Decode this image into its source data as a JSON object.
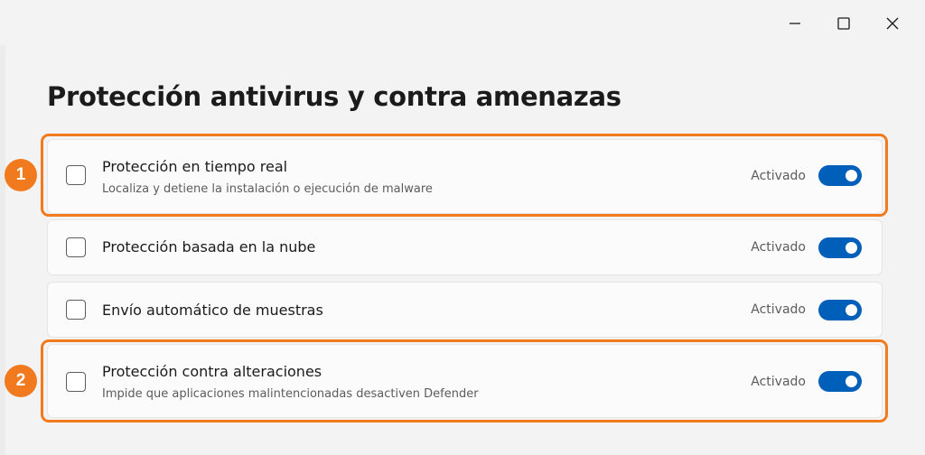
{
  "window": {
    "controls": {
      "minimize_icon": "minimize-icon",
      "maximize_icon": "maximize-icon",
      "close_icon": "close-icon"
    }
  },
  "page": {
    "title": "Protección antivirus y contra amenazas"
  },
  "settings": [
    {
      "title": "Protección en tiempo real",
      "subtitle": "Localiza y detiene la instalación o ejecución de malware",
      "state": "Activado",
      "enabled": true
    },
    {
      "title": "Protección basada en la nube",
      "state": "Activado",
      "enabled": true
    },
    {
      "title": "Envío automático de muestras",
      "state": "Activado",
      "enabled": true
    },
    {
      "title": "Protección contra alteraciones",
      "subtitle": "Impide que aplicaciones malintencionadas desactiven Defender",
      "state": "Activado",
      "enabled": true
    }
  ],
  "annotations": [
    {
      "label": "1"
    },
    {
      "label": "2"
    }
  ],
  "colors": {
    "accent": "#005fb8",
    "highlight": "#f07a1d"
  }
}
